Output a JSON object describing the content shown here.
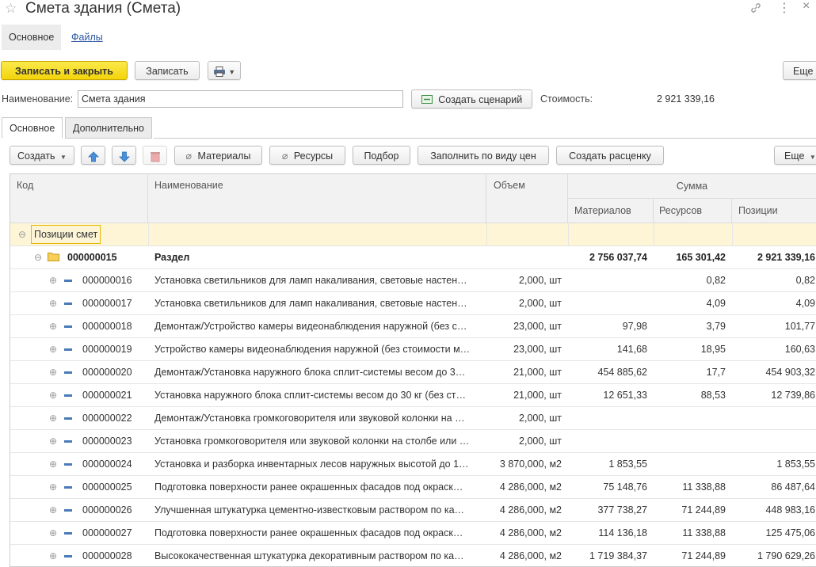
{
  "window": {
    "title": "Смета здания (Смета)"
  },
  "nav_tabs": [
    {
      "label": "Основное"
    },
    {
      "label": "Файлы"
    }
  ],
  "toolbar": {
    "save_close": "Записать и закрыть",
    "save": "Записать",
    "more": "Еще",
    "print_icon": "printer-icon"
  },
  "form": {
    "name_label": "Наименование:",
    "name_value": "Смета здания",
    "scenario_button": "Создать сценарий",
    "cost_label": "Стоимость:",
    "cost_value": "2 921 339,16"
  },
  "inner_tabs": [
    {
      "label": "Основное"
    },
    {
      "label": "Дополнительно"
    }
  ],
  "grid_toolbar": {
    "create": "Создать",
    "materials": "Материалы",
    "resources": "Ресурсы",
    "selection": "Подбор",
    "fill_by_price": "Заполнить по виду цен",
    "create_rate": "Создать расценку",
    "more": "Еще"
  },
  "columns": {
    "code": "Код",
    "name": "Наименование",
    "volume": "Объем",
    "sum": "Сумма",
    "materials": "Материалов",
    "resources": "Ресурсов",
    "positions": "Позиции"
  },
  "group_row": {
    "label": "Позиции смет"
  },
  "section_row": {
    "code": "000000015",
    "name": "Раздел",
    "materials": "2 756 037,74",
    "resources": "165 301,42",
    "positions": "2 921 339,16"
  },
  "rows": [
    {
      "code": "000000016",
      "name": "Установка светильников для ламп накаливания, световые настен…",
      "volume": "2,000, шт",
      "materials": "",
      "resources": "0,82",
      "positions": "0,82"
    },
    {
      "code": "000000017",
      "name": "Установка светильников для ламп накаливания, световые настен…",
      "volume": "2,000, шт",
      "materials": "",
      "resources": "4,09",
      "positions": "4,09"
    },
    {
      "code": "000000018",
      "name": "Демонтаж/Устройство камеры видеонаблюдения наружной (без с…",
      "volume": "23,000, шт",
      "materials": "97,98",
      "resources": "3,79",
      "positions": "101,77"
    },
    {
      "code": "000000019",
      "name": "Устройство камеры видеонаблюдения наружной (без стоимости м…",
      "volume": "23,000, шт",
      "materials": "141,68",
      "resources": "18,95",
      "positions": "160,63"
    },
    {
      "code": "000000020",
      "name": "Демонтаж/Установка наружного блока сплит-системы весом до 3…",
      "volume": "21,000, шт",
      "materials": "454 885,62",
      "resources": "17,7",
      "positions": "454 903,32"
    },
    {
      "code": "000000021",
      "name": "Установка наружного блока сплит-системы весом до 30 кг (без ст…",
      "volume": "21,000, шт",
      "materials": "12 651,33",
      "resources": "88,53",
      "positions": "12 739,86"
    },
    {
      "code": "000000022",
      "name": "Демонтаж/Установка громкоговорителя или звуковой колонки на …",
      "volume": "2,000, шт",
      "materials": "",
      "resources": "",
      "positions": ""
    },
    {
      "code": "000000023",
      "name": "Установка громкоговорителя или звуковой колонки на столбе или …",
      "volume": "2,000, шт",
      "materials": "",
      "resources": "",
      "positions": ""
    },
    {
      "code": "000000024",
      "name": "Установка и разборка инвентарных лесов наружных высотой до 1…",
      "volume": "3 870,000, м2",
      "materials": "1 853,55",
      "resources": "",
      "positions": "1 853,55"
    },
    {
      "code": "000000025",
      "name": "Подготовка поверхности ранее окрашенных фасадов под окраск…",
      "volume": "4 286,000, м2",
      "materials": "75 148,76",
      "resources": "11 338,88",
      "positions": "86 487,64"
    },
    {
      "code": "000000026",
      "name": "Улучшенная штукатурка цементно-известковым раствором по ка…",
      "volume": "4 286,000, м2",
      "materials": "377 738,27",
      "resources": "71 244,89",
      "positions": "448 983,16"
    },
    {
      "code": "000000027",
      "name": "Подготовка поверхности ранее окрашенных фасадов под окраск…",
      "volume": "4 286,000, м2",
      "materials": "114 136,18",
      "resources": "11 338,88",
      "positions": "125 475,06"
    },
    {
      "code": "000000028",
      "name": "Высококачественная штукатурка декоративным раствором по ка…",
      "volume": "4 286,000, м2",
      "materials": "1 719 384,37",
      "resources": "71 244,89",
      "positions": "1 790 629,26"
    }
  ]
}
